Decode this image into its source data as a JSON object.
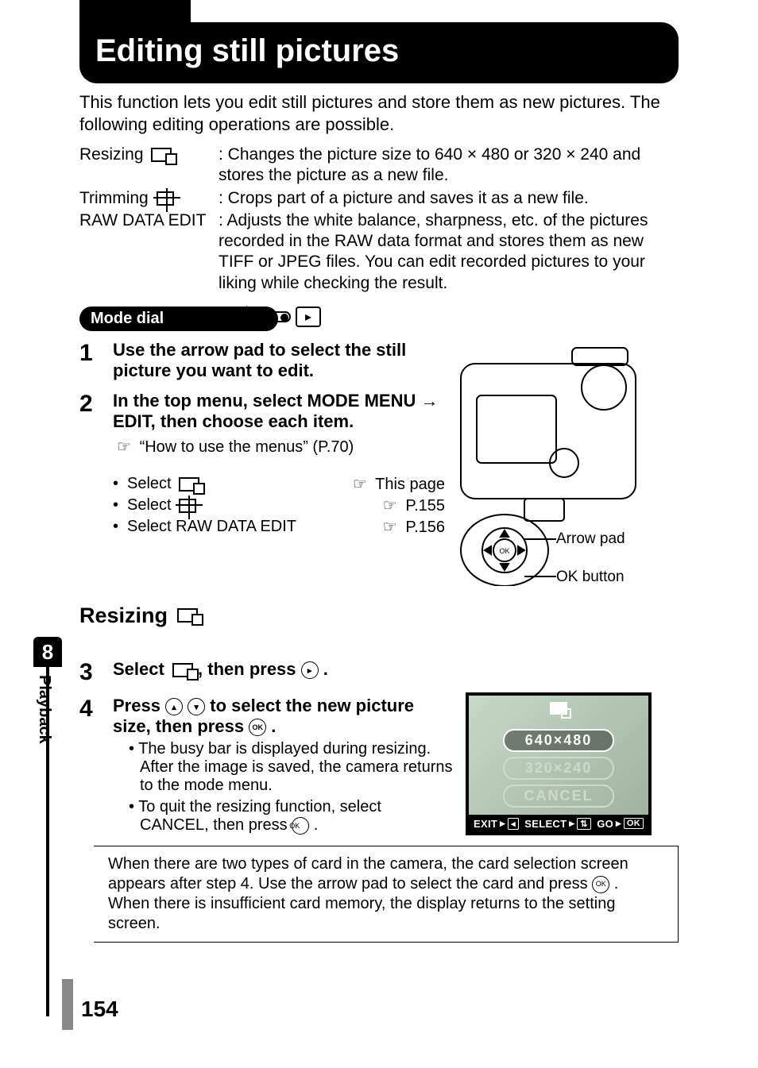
{
  "title": "Editing still pictures",
  "intro": "This function lets you edit still pictures and store them as new pictures. The following editing operations are possible.",
  "defs": {
    "resizing_term": "Resizing",
    "resizing_desc": "Changes the picture size to 640 × 480 or 320 × 240 and stores the picture as a new file.",
    "trimming_term": "Trimming",
    "trimming_desc": "Crops part of a picture and saves it as a new file.",
    "raw_term": "RAW DATA EDIT",
    "raw_desc": "Adjusts the white balance, sharpness, etc. of the pictures recorded in the RAW data format and stores them as new TIFF or JPEG files. You can edit recorded pictures to your liking while checking the result."
  },
  "mode_dial_label": "Mode dial",
  "steps": {
    "s1": "Use the arrow pad to select the still picture you want to edit.",
    "s2": "In the top menu, select MODE MENU → EDIT, then choose each item.",
    "s2_ref": "“How to use the menus” (P.70)",
    "b1_text": "Select",
    "b1_ref": "This page",
    "b2_text": "Select",
    "b2_ref": "P.155",
    "b3_text": "Select RAW DATA EDIT",
    "b3_ref": "P.156"
  },
  "labels": {
    "arrow_pad": "Arrow pad",
    "ok_button": "OK button"
  },
  "section_resize": "Resizing",
  "steps2": {
    "s3_a": "Select ",
    "s3_b": " , then press ",
    "s3_c": " .",
    "s4_a": "Press ",
    "s4_b": " to select the new picture size, then press ",
    "s4_c": " .",
    "sb1": "The busy bar is displayed during resizing. After the image is saved, the camera returns to the mode menu.",
    "sb2": "To quit the resizing function, select CANCEL, then press "
  },
  "screen": {
    "opt1": "640×480",
    "opt2": "320×240",
    "opt3": "CANCEL",
    "bar_exit": "EXIT",
    "bar_select": "SELECT",
    "bar_go": "GO",
    "bar_ok": "OK"
  },
  "note": {
    "p1": "When there are two types of card in the camera, the card selection screen appears after step 4. Use the arrow pad to select the card and press ",
    "p1b": " .",
    "p2": "When there is insufficient card memory, the display returns to the setting screen."
  },
  "side": {
    "chapter": "8",
    "label": "Playback"
  },
  "page_number": "154",
  "chart_data": {
    "type": "table",
    "title": "Editing operations and page references",
    "rows": [
      {
        "operation": "Resizing",
        "reference": "This page"
      },
      {
        "operation": "Trimming",
        "reference": "P.155"
      },
      {
        "operation": "RAW DATA EDIT",
        "reference": "P.156"
      }
    ]
  }
}
